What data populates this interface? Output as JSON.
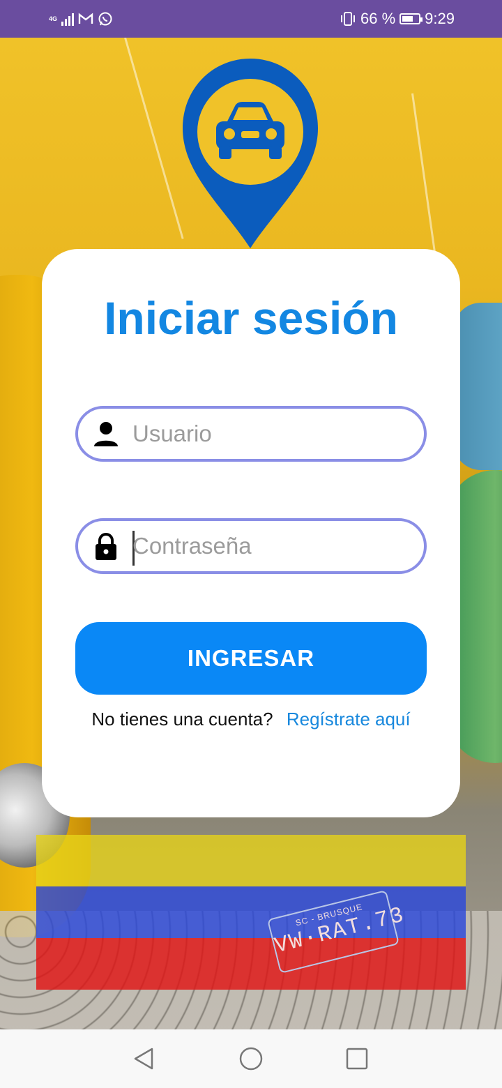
{
  "status_bar": {
    "network_label": "4G",
    "battery_percent": "66 %",
    "battery_level": 66,
    "time": "9:29",
    "icons": [
      "signal-icon",
      "gmail-icon",
      "whatsapp-icon",
      "vibrate-icon",
      "battery-icon"
    ]
  },
  "logo": {
    "icon": "car-location-pin-icon",
    "color": "#0b5cbd"
  },
  "login": {
    "title": "Iniciar sesión",
    "username_placeholder": "Usuario",
    "username_value": "",
    "password_placeholder": "Contraseña",
    "password_value": "",
    "submit_label": "INGRESAR",
    "register_prompt": "No tienes una cuenta?",
    "register_link": "Regístrate aquí"
  },
  "background": {
    "plate_top": "SC - BRUSQUE",
    "plate_main": "VW·RAT.73",
    "flag_colors": [
      "#e6d219",
      "#2846dc",
      "#e11414"
    ]
  },
  "colors": {
    "accent": "#0a88f6",
    "title": "#1387e2",
    "field_border": "#8a8ee6",
    "status_bar": "#6a4d9f"
  },
  "nav": {
    "icons": [
      "back-icon",
      "home-icon",
      "recents-icon"
    ]
  }
}
